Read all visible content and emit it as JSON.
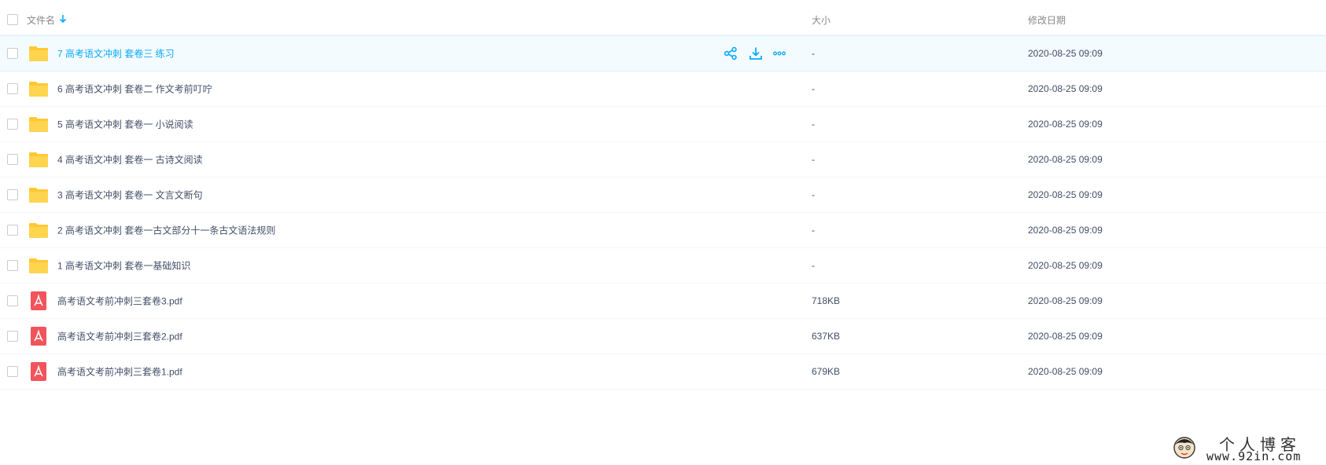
{
  "header": {
    "name_label": "文件名",
    "size_label": "大小",
    "date_label": "修改日期"
  },
  "files": [
    {
      "type": "folder",
      "name": "7 高考语文冲刺 套卷三 练习",
      "size": "-",
      "date": "2020-08-25 09:09",
      "hover": true
    },
    {
      "type": "folder",
      "name": "6 高考语文冲刺 套卷二 作文考前叮咛",
      "size": "-",
      "date": "2020-08-25 09:09"
    },
    {
      "type": "folder",
      "name": "5 高考语文冲刺 套卷一 小说阅读",
      "size": "-",
      "date": "2020-08-25 09:09"
    },
    {
      "type": "folder",
      "name": "4 高考语文冲刺 套卷一 古诗文阅读",
      "size": "-",
      "date": "2020-08-25 09:09"
    },
    {
      "type": "folder",
      "name": "3 高考语文冲刺 套卷一 文言文断句",
      "size": "-",
      "date": "2020-08-25 09:09"
    },
    {
      "type": "folder",
      "name": "2 高考语文冲刺 套卷一古文部分十一条古文语法规则",
      "size": "-",
      "date": "2020-08-25 09:09"
    },
    {
      "type": "folder",
      "name": "1 高考语文冲刺 套卷一基础知识",
      "size": "-",
      "date": "2020-08-25 09:09"
    },
    {
      "type": "pdf",
      "name": "高考语文考前冲刺三套卷3.pdf",
      "size": "718KB",
      "date": "2020-08-25 09:09"
    },
    {
      "type": "pdf",
      "name": "高考语文考前冲刺三套卷2.pdf",
      "size": "637KB",
      "date": "2020-08-25 09:09"
    },
    {
      "type": "pdf",
      "name": "高考语文考前冲刺三套卷1.pdf",
      "size": "679KB",
      "date": "2020-08-25 09:09"
    }
  ],
  "row_actions": [
    "share-icon",
    "download-icon",
    "more-icon"
  ],
  "watermark": {
    "title": "个人博客",
    "url": "www.92in.com"
  },
  "colors": {
    "accent": "#09aaff",
    "folder": "#ffd04b",
    "pdf": "#f2545b",
    "text": "#424e67",
    "header_text": "#888888",
    "hover_bg": "#f4fbff"
  }
}
